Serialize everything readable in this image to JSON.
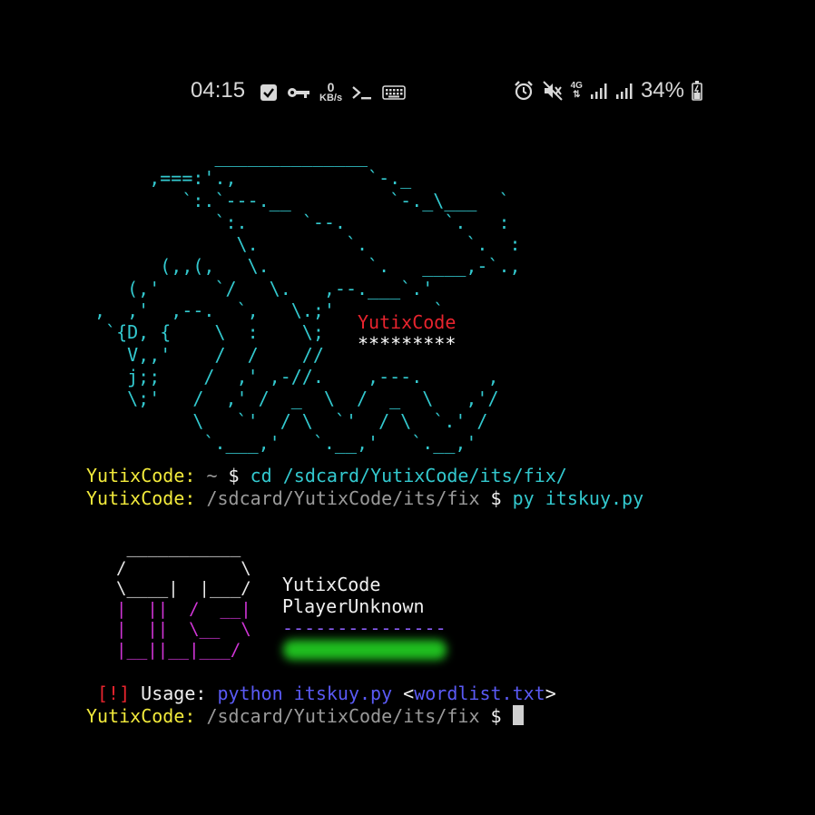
{
  "statusbar": {
    "time": "04:15",
    "net_speed_value": "0",
    "net_speed_unit": "KB/s",
    "network_type": "4G",
    "battery": "34%",
    "icons_left": [
      "checkbox-icon",
      "key-icon",
      "net-speed-icon",
      "terminal-icon",
      "keyboard-icon"
    ],
    "icons_right": [
      "alarm-icon",
      "mute-icon",
      "network-4g-icon",
      "signal-icon",
      "signal-icon",
      "battery-icon"
    ]
  },
  "banner": {
    "name": "YutixCode",
    "password_mask": "*********"
  },
  "terminal": {
    "line1": {
      "user": "YutixCode:",
      "path": " ~ ",
      "prompt": "$ ",
      "command": "cd /sdcard/YutixCode/its/fix/"
    },
    "line2": {
      "user": "YutixCode:",
      "path": " /sdcard/YutixCode/its/fix ",
      "prompt": "$ ",
      "command": "py itskuy.py"
    },
    "info": {
      "author": "YutixCode",
      "subtitle": "PlayerUnknown",
      "separator": "---------------"
    },
    "usage": {
      "marker": "[!]",
      "label": " Usage: ",
      "cmd": "python itskuy.py",
      "lt": " <",
      "arg": "wordlist.txt",
      "gt": ">"
    },
    "line3": {
      "user": "YutixCode:",
      "path": " /sdcard/YutixCode/its/fix ",
      "prompt": "$ "
    }
  }
}
